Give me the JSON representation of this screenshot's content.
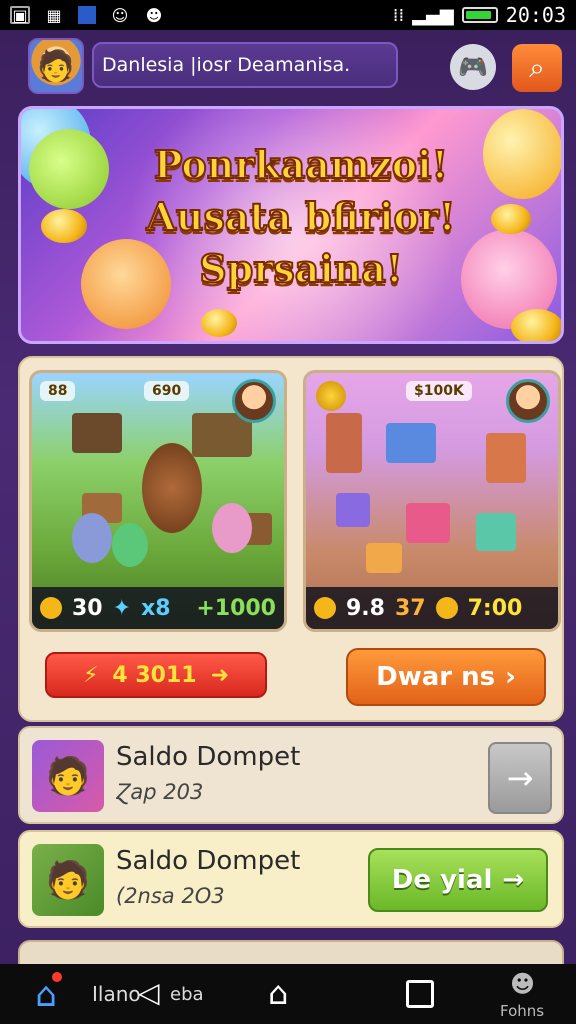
{
  "status_bar": {
    "left_icons": [
      "photo-icon",
      "grid-icon",
      "notification-icon",
      "face-icon",
      "face-icon"
    ],
    "time": "20:03"
  },
  "header": {
    "title": "Danlesia |iosr Deamanisa.",
    "avatar_icon": "player-avatar",
    "gamepad_icon": "gamepad-icon",
    "search_icon": "search-icon"
  },
  "banner": {
    "lines": [
      "Ponrkaamzoi!",
      "Ausata bfirior!",
      "Sprsaina!"
    ]
  },
  "games": [
    {
      "tag": "88",
      "top_label": "690",
      "stats": [
        {
          "text": "30",
          "color": "#ffffff"
        },
        {
          "text": "x8",
          "color": "#5ad0ff"
        },
        {
          "text": "+1000",
          "color": "#8ae05a"
        }
      ]
    },
    {
      "tag": "$100K",
      "stats": [
        {
          "text": "9.8",
          "color": "#ffffff"
        },
        {
          "text": "37",
          "color": "#ffb23a"
        },
        {
          "text": "7:00",
          "color": "#ffe23a"
        }
      ]
    }
  ],
  "actions": {
    "red_button_label": "4 3011",
    "orange_button_label": "Dwar ns"
  },
  "wallets": [
    {
      "title": "Saldo Dompet",
      "subtitle": "Ɀap 203",
      "action": "→"
    },
    {
      "title": "Saldo Dompet",
      "subtitle": "(2nsa 2O3",
      "action_label": "De yial"
    }
  ],
  "navbar": {
    "label_left": "Ilano",
    "label_mid": "eba",
    "label_right": "Fohns"
  },
  "colors": {
    "background": "#3a1f5c",
    "accent_orange": "#e2621a",
    "accent_red": "#d9281e",
    "accent_green": "#6ab828"
  }
}
